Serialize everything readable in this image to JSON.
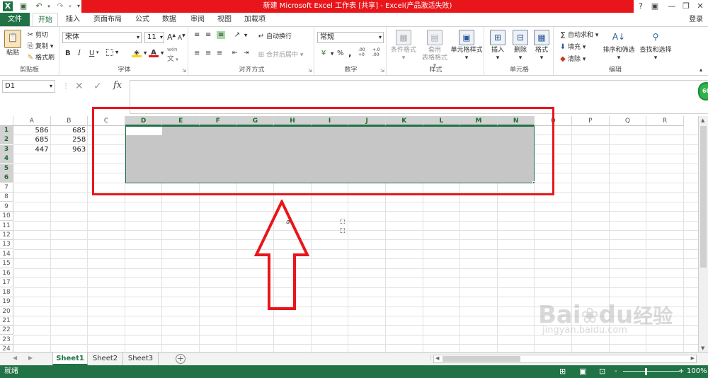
{
  "window": {
    "title": "新建 Microsoft Excel 工作表  [共享] - Excel(产品激活失败)",
    "help": "?",
    "login": "登录"
  },
  "tabs": [
    "文件",
    "开始",
    "插入",
    "页面布局",
    "公式",
    "数据",
    "审阅",
    "视图",
    "加载项"
  ],
  "ribbon": {
    "clipboard": {
      "label": "剪贴板",
      "paste": "粘贴",
      "cut": "剪切",
      "copy": "复制",
      "format_painter": "格式刷"
    },
    "font": {
      "label": "字体",
      "font_name": "宋体",
      "font_size": "11",
      "bold": "B",
      "italic": "I",
      "underline": "U",
      "increase": "A",
      "decrease": "A",
      "font_color": "A",
      "wen": "wén"
    },
    "alignment": {
      "label": "对齐方式",
      "wrap": "自动换行",
      "merge": "合并后居中"
    },
    "number": {
      "label": "数字",
      "format": "常规",
      "percent": "%",
      "comma": ",",
      "inc": ".00 +0",
      "dec": "+.0 .00"
    },
    "styles": {
      "label": "样式",
      "conditional": "条件格式",
      "table_line1": "套用",
      "table_line2": "表格格式",
      "cell_styles": "单元格样式"
    },
    "cells": {
      "label": "单元格",
      "insert": "插入",
      "delete": "删除",
      "format": "格式"
    },
    "editing": {
      "label": "编辑",
      "autosum": "自动求和",
      "fill": "填充",
      "clear": "清除",
      "sort": "排序和筛选",
      "find": "查找和选择"
    }
  },
  "formula_bar": {
    "name_box": "D1",
    "fx": "fx",
    "content": ""
  },
  "columns": [
    "A",
    "B",
    "C",
    "D",
    "E",
    "F",
    "G",
    "H",
    "I",
    "J",
    "K",
    "L",
    "M",
    "N",
    "O",
    "P",
    "Q",
    "R"
  ],
  "rows": [
    "1",
    "2",
    "3",
    "4",
    "5",
    "6",
    "7",
    "8",
    "9",
    "10",
    "11",
    "12",
    "13",
    "14",
    "15",
    "16",
    "17",
    "18",
    "19",
    "20",
    "21",
    "22",
    "23",
    "24"
  ],
  "cells": {
    "A1": "586",
    "B1": "685",
    "A2": "685",
    "B2": "258",
    "A3": "447",
    "B3": "963"
  },
  "stray_glyph": "a",
  "sheets": [
    "Sheet1",
    "Sheet2",
    "Sheet3"
  ],
  "status": {
    "ready": "就绪",
    "zoom": "100%",
    "minus": "-",
    "plus": "+"
  },
  "float_badge": "60",
  "watermark": {
    "brand": "Bai",
    "brand2": "du",
    "cn": "经验",
    "url": "jingyan.baidu.com"
  },
  "colors": {
    "excel_green": "#217346",
    "title_red": "#e8161b",
    "selection_gray": "#c6c6c6",
    "highlight_red": "#e8161b"
  }
}
